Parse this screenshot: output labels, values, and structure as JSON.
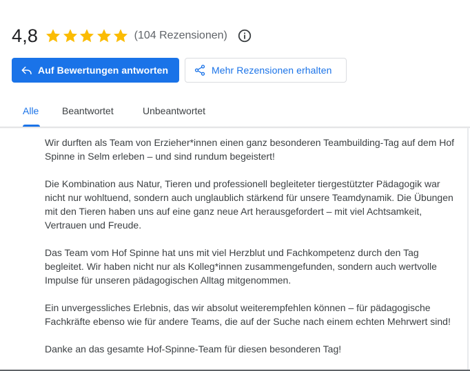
{
  "summary": {
    "rating": "4,8",
    "stars": 5,
    "review_count": "(104 Rezensionen)"
  },
  "buttons": {
    "reply_label": "Auf Bewertungen antworten",
    "more_reviews_label": "Mehr Rezensionen erhalten"
  },
  "tabs": [
    {
      "label": "Alle",
      "active": true
    },
    {
      "label": "Beantwortet",
      "active": false
    },
    {
      "label": "Unbeantwortet",
      "active": false
    }
  ],
  "review": {
    "paragraphs": [
      "Wir durften als Team von Erzieher*innen einen ganz besonderen Teambuilding-Tag auf dem Hof Spinne in Selm erleben – und sind rundum begeistert!",
      "Die Kombination aus Natur, Tieren und professionell begleiteter tiergestützter Pädagogik war nicht nur wohltuend, sondern auch unglaublich stärkend für unsere Teamdynamik. Die Übungen mit den Tieren haben uns auf eine ganz neue Art herausgefordert – mit viel Achtsamkeit, Vertrauen und Freude.",
      "Das Team vom Hof Spinne hat uns mit viel Herzblut und Fachkompetenz durch den Tag begleitet. Wir haben nicht nur als Kolleg*innen zusammengefunden, sondern auch wertvolle Impulse für unseren pädagogischen Alltag mitgenommen.",
      "Ein unvergessliches Erlebnis, das wir absolut weiterempfehlen können – für pädagogische Fachkräfte ebenso wie für andere Teams, die auf der Suche nach einem echten Mehrwert sind!",
      "Danke an das gesamte Hof-Spinne-Team für diesen besonderen Tag!"
    ]
  },
  "colors": {
    "accent": "#1a73e8",
    "star": "#fbbc04",
    "muted_text": "#5f6368"
  },
  "icons": {
    "reply": "reply-icon",
    "share": "share-icon",
    "info": "info-icon",
    "star": "star-icon"
  }
}
